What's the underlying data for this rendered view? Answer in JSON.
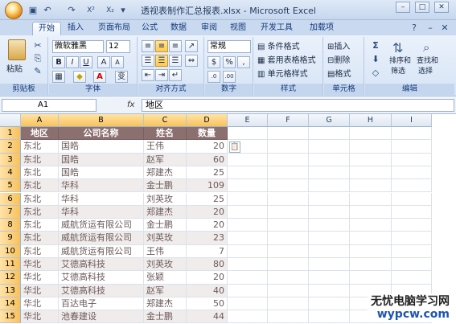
{
  "titlebar": {
    "title": "透视表制作汇总报表.xlsx - Microsoft Excel",
    "min_icon": "minimize-icon",
    "max_icon": "maximize-icon",
    "close_icon": "close-icon"
  },
  "tabs": [
    "开始",
    "插入",
    "页面布局",
    "公式",
    "数据",
    "审阅",
    "视图",
    "开发工具",
    "加载项"
  ],
  "ribbon": {
    "clipboard": {
      "label": "剪贴板",
      "paste": "粘贴"
    },
    "font": {
      "label": "字体",
      "font_name": "微软雅黑",
      "font_size": "12",
      "bold": "B",
      "italic": "I",
      "underline": "U",
      "grow": "A",
      "shrink": "A",
      "wen": "变"
    },
    "alignment": {
      "label": "对齐方式"
    },
    "number": {
      "label": "数字",
      "format": "常规",
      "pct": "%",
      "comma": ","
    },
    "styles": {
      "label": "样式",
      "cond": "条件格式",
      "table": "套用表格格式",
      "cellstyle": "单元格样式"
    },
    "cells": {
      "label": "单元格",
      "insert": "插入",
      "delete": "删除",
      "format": "格式"
    },
    "editing": {
      "label": "编辑",
      "sort": "排序和",
      "sort2": "筛选",
      "find": "查找和",
      "find2": "选择"
    }
  },
  "formula_bar": {
    "name_box": "A1",
    "fx": "fx",
    "content": "地区"
  },
  "columns": [
    "A",
    "B",
    "C",
    "D",
    "E",
    "F",
    "G",
    "H",
    "I"
  ],
  "table": {
    "headers": [
      "地区",
      "公司名称",
      "姓名",
      "数量"
    ],
    "rows": [
      [
        "东北",
        "国皓",
        "王伟",
        "20"
      ],
      [
        "东北",
        "国皓",
        "赵军",
        "60"
      ],
      [
        "东北",
        "国皓",
        "郑建杰",
        "25"
      ],
      [
        "东北",
        "华科",
        "金士鹏",
        "109"
      ],
      [
        "东北",
        "华科",
        "刘英玫",
        "25"
      ],
      [
        "东北",
        "华科",
        "郑建杰",
        "20"
      ],
      [
        "东北",
        "威航货运有限公司",
        "金士鹏",
        "20"
      ],
      [
        "东北",
        "威航货运有限公司",
        "刘英玫",
        "23"
      ],
      [
        "东北",
        "威航货运有限公司",
        "王伟",
        "7"
      ],
      [
        "华北",
        "艾德高科技",
        "刘英玫",
        "80"
      ],
      [
        "华北",
        "艾德高科技",
        "张颖",
        "20"
      ],
      [
        "华北",
        "艾德高科技",
        "赵军",
        "40"
      ],
      [
        "华北",
        "百达电子",
        "郑建杰",
        "50"
      ],
      [
        "华北",
        "池春建设",
        "金士鹏",
        "44"
      ]
    ],
    "row_numbers": [
      "1",
      "2",
      "3",
      "4",
      "5",
      "6",
      "7",
      "8",
      "9",
      "10",
      "11",
      "12",
      "13",
      "14",
      "15"
    ]
  },
  "watermark": {
    "line1": "无忧电脑学习网",
    "line2": "wypcw.com"
  },
  "colors": {
    "header_fill": "#8c6f6f",
    "alt_row": "#f1ecec",
    "text": "#6b5a5a"
  }
}
